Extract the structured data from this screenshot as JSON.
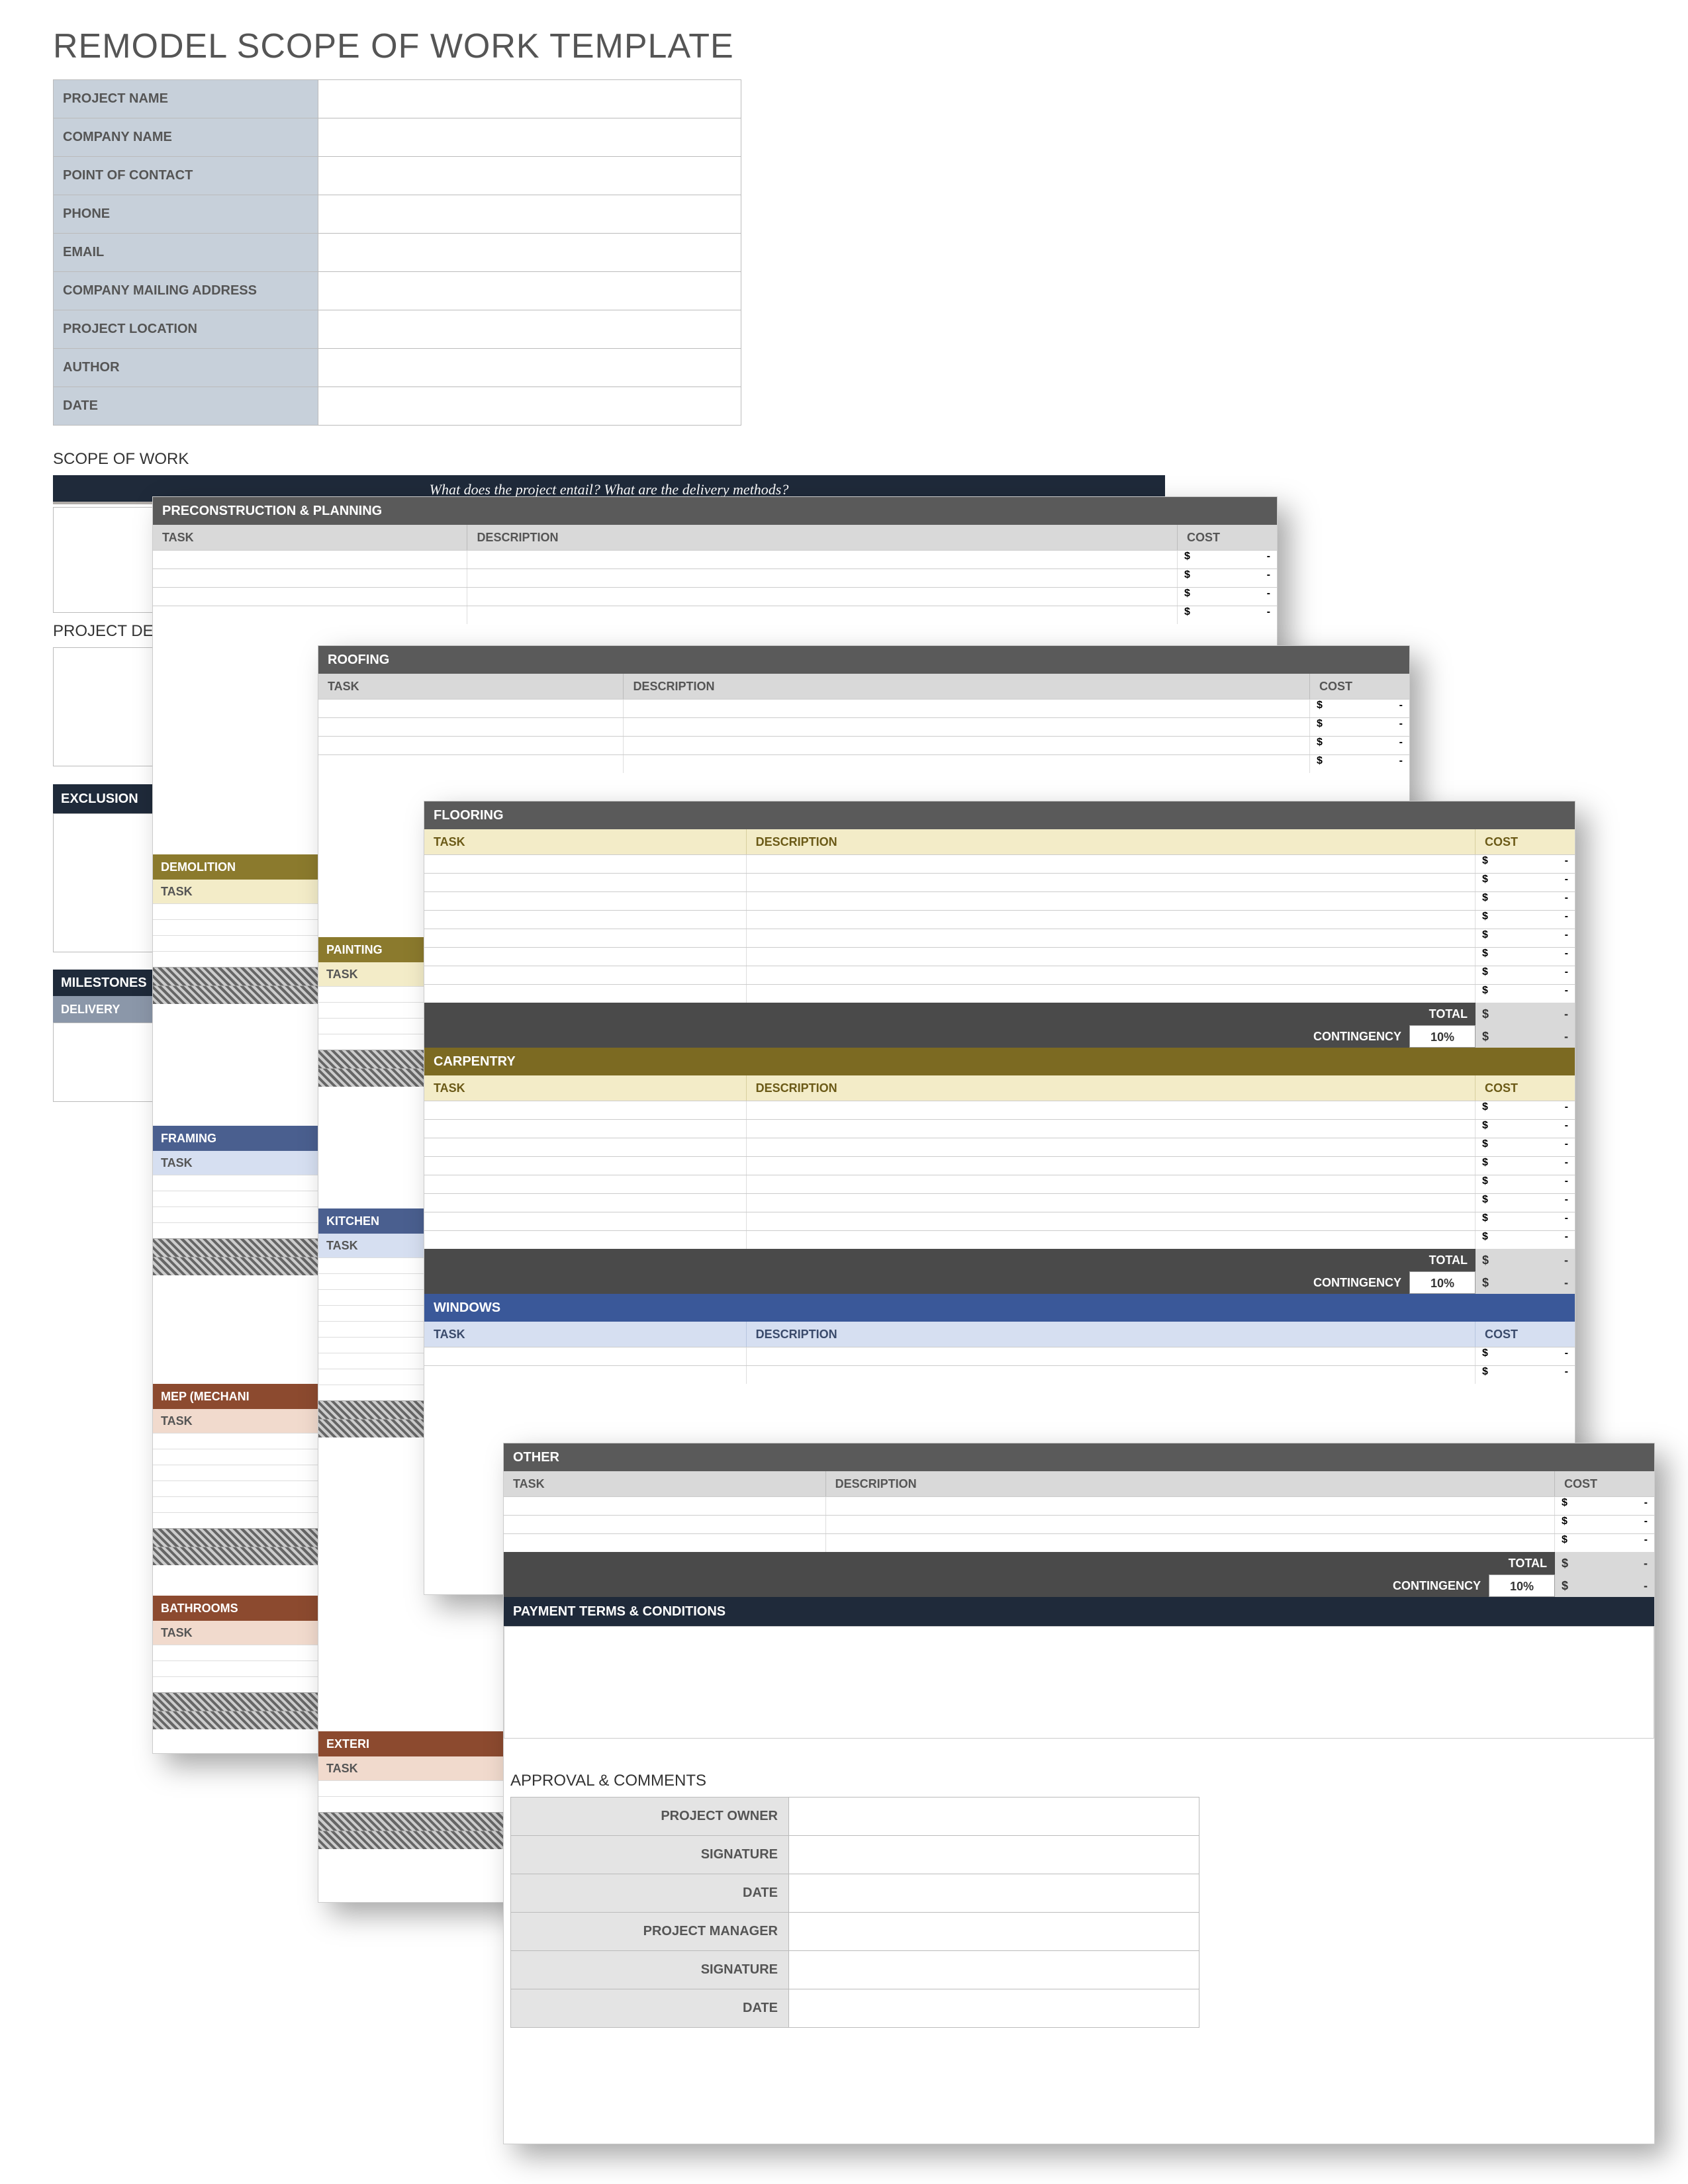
{
  "title": "REMODEL SCOPE OF WORK TEMPLATE",
  "info_labels": [
    "PROJECT NAME",
    "COMPANY NAME",
    "POINT OF CONTACT",
    "PHONE",
    "EMAIL",
    "COMPANY MAILING ADDRESS",
    "PROJECT LOCATION",
    "AUTHOR",
    "DATE"
  ],
  "sow_heading": "SCOPE OF WORK",
  "sow_question": "What does the project entail?  What are the delivery methods?",
  "pd_heading": "PROJECT DEL",
  "exclusions": "EXCLUSION",
  "milestones": "MILESTONES",
  "delivery": "DELIVERY",
  "col_task": "TASK",
  "col_desc": "DESCRIPTION",
  "col_cost": "COST",
  "dollar": "$",
  "dash": "-",
  "total": "TOTAL",
  "contingency": "CONTINGENCY",
  "contingency_pct": "10%",
  "sections": {
    "precon": "PRECONSTRUCTION & PLANNING",
    "roofing": "ROOFING",
    "flooring": "FLOORING",
    "carpentry": "CARPENTRY",
    "windows": "WINDOWS",
    "other": "OTHER",
    "demolition": "DEMOLITION",
    "painting": "PAINTING",
    "framing": "FRAMING",
    "kitchen": "KITCHEN",
    "mep": "MEP (MECHANI",
    "bathrooms": "BATHROOMS",
    "exterior": "EXTERI"
  },
  "payment": "PAYMENT TERMS & CONDITIONS",
  "approval": "APPROVAL & COMMENTS",
  "approval_labels": [
    "PROJECT OWNER",
    "SIGNATURE",
    "DATE",
    "PROJECT MANAGER",
    "SIGNATURE",
    "DATE"
  ]
}
